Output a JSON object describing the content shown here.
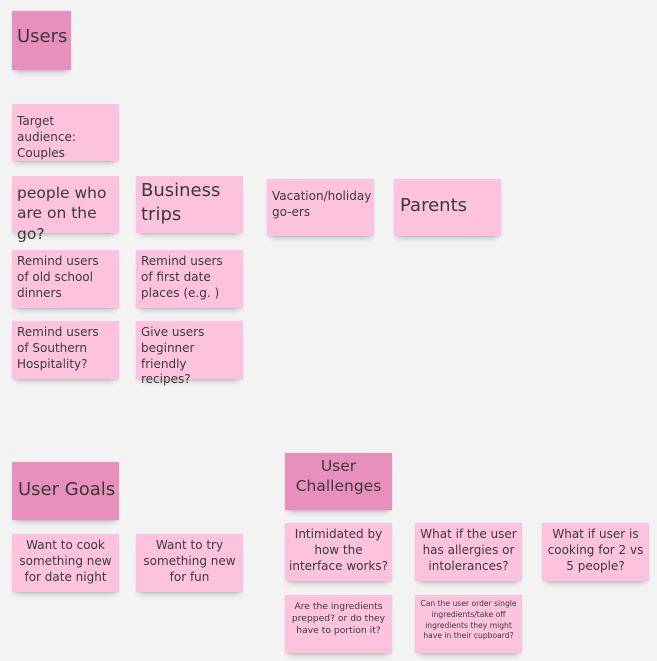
{
  "sections": {
    "users": "Users",
    "user_goals": "User Goals",
    "user_challenges": "User Challenges"
  },
  "users_notes": {
    "target_audience": "Target audience: Couples",
    "on_the_go": "people who are on the go?",
    "business_trips": "Business trips",
    "vacation": "Vacation/holiday go-ers",
    "parents": "Parents",
    "old_school": "Remind users of old school dinners",
    "first_date": "Remind users of first date places (e.g. )",
    "southern": "Remind users of Southern Hospitality?",
    "beginner": "Give users beginner friendly recipes?"
  },
  "goals_notes": {
    "date_night": "Want to cook something new for date night",
    "for_fun": "Want to try something new for fun"
  },
  "challenges_notes": {
    "interface": "Intimidated by how the interface works?",
    "allergies": "What if the user has allergies or intolerances?",
    "cooking_count": "What if user is cooking for 2 vs 5 people?",
    "prepped": "Are the ingredients prepped? or do they have to portion it?",
    "single_ingredients": "Can the user order single ingredients/take off ingredients they might have in their cupboard?"
  },
  "colors": {
    "note_light": "#fdc3dc",
    "note_header": "#e88fbc",
    "canvas": "#f3f3f3"
  }
}
